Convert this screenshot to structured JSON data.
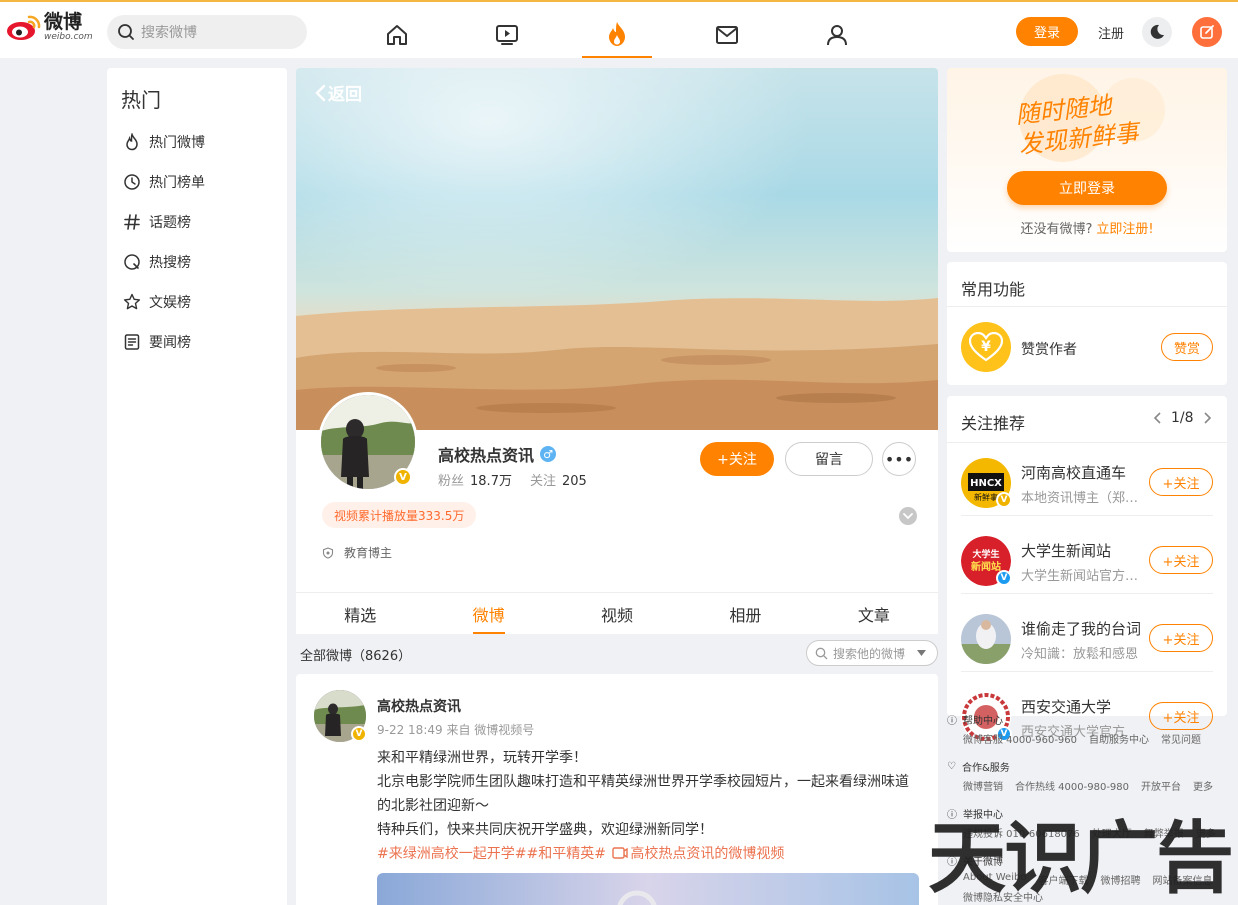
{
  "colors": {
    "accent": "#ff8200",
    "highlight": "#eb7350",
    "verified_yellow": "#f0b400",
    "verified_blue": "#1d9bf0"
  },
  "header": {
    "logo_cn": "微博",
    "logo_en": "weibo.com",
    "search_placeholder": "搜索微博",
    "nav": [
      "home-icon",
      "video-icon",
      "hot-flame-icon",
      "mail-icon",
      "profile-icon"
    ],
    "active_nav": "hot-flame-icon",
    "login": "登录",
    "register": "注册"
  },
  "sidebar": {
    "title": "热门",
    "items": [
      {
        "label": "热门微博",
        "icon": "flame-icon"
      },
      {
        "label": "热门榜单",
        "icon": "clock-icon"
      },
      {
        "label": "话题榜",
        "icon": "hash-icon"
      },
      {
        "label": "热搜榜",
        "icon": "search-circle-icon"
      },
      {
        "label": "文娱榜",
        "icon": "star-icon"
      },
      {
        "label": "要闻榜",
        "icon": "news-icon"
      }
    ]
  },
  "profile": {
    "back": "返回",
    "name": "高校热点资讯",
    "gender": "♂",
    "fans_label": "粉丝",
    "fans": "18.7万",
    "follow_label": "关注",
    "follow": "205",
    "follow_btn": "+关注",
    "message_btn": "留言",
    "more_btn": "•••",
    "play_tag": "视频累计播放量333.5万",
    "badge": "教育博主",
    "verified_mark": "V"
  },
  "tabs": [
    {
      "label": "精选"
    },
    {
      "label": "微博"
    },
    {
      "label": "视频"
    },
    {
      "label": "相册"
    },
    {
      "label": "文章"
    }
  ],
  "active_tab": "微博",
  "feed_filter": {
    "label": "全部微博（8626）",
    "search_placeholder": "搜索他的微博"
  },
  "post": {
    "author": "高校热点资讯",
    "meta": "9-22 18:49 来自 微博视频号",
    "line1": "来和平精绿洲世界，玩转开学季！",
    "line2": "北京电影学院师生团队趣味打造和平精英绿洲世界开学季校园短片，一起来看绿洲味道的北影社团迎新～",
    "line3": "特种兵们，快来共同庆祝开学盛典，欢迎绿洲新同学！",
    "tags": "#来绿洲高校一起开学##和平精英# ",
    "video_link": "高校热点资讯的微博视频"
  },
  "promo": {
    "slogan_line1": "随时随地",
    "slogan_line2": "发现新鲜事",
    "login": "立即登录",
    "no_account": "还没有微博?",
    "register": "立即注册!"
  },
  "functions": {
    "title": "常用功能",
    "item": "赞赏作者",
    "btn": "赞赏",
    "icon_char": "¥"
  },
  "recommend": {
    "title": "关注推荐",
    "page": "1/8",
    "items": [
      {
        "name": "河南高校直通车",
        "desc": "本地资讯博主（郑州）",
        "btn": "+关注",
        "avatar_text": "HNCX 新鲜事"
      },
      {
        "name": "大学生新闻站",
        "desc": "大学生新闻站官方微博",
        "btn": "+关注",
        "avatar_text": "大学生 新闻站"
      },
      {
        "name": "谁偷走了我的台词",
        "desc": "冷知識：放鬆和感恩",
        "btn": "+关注",
        "avatar_text": ""
      },
      {
        "name": "西安交通大学",
        "desc": "西安交通大学官方",
        "btn": "+关注",
        "avatar_text": ""
      }
    ]
  },
  "footer": {
    "help": {
      "title": "帮助中心",
      "links": [
        "微博客服 4000-960-960",
        "自助服务中心",
        "常见问题"
      ]
    },
    "coop": {
      "title": "合作&服务",
      "links": [
        "微博营销",
        "合作热线 4000-980-980",
        "开放平台",
        "更多"
      ]
    },
    "report": {
      "title": "举报中心",
      "links": [
        "违规投诉 010-60618076",
        "处理大厅",
        "舞弊举报",
        "更多"
      ]
    },
    "about": {
      "title": "关于微博",
      "links": [
        "About Weibo",
        "客户端下载",
        "微博招聘",
        "网站备案信息"
      ],
      "extra": "微博隐私安全中心"
    }
  },
  "watermark": "天识广告"
}
